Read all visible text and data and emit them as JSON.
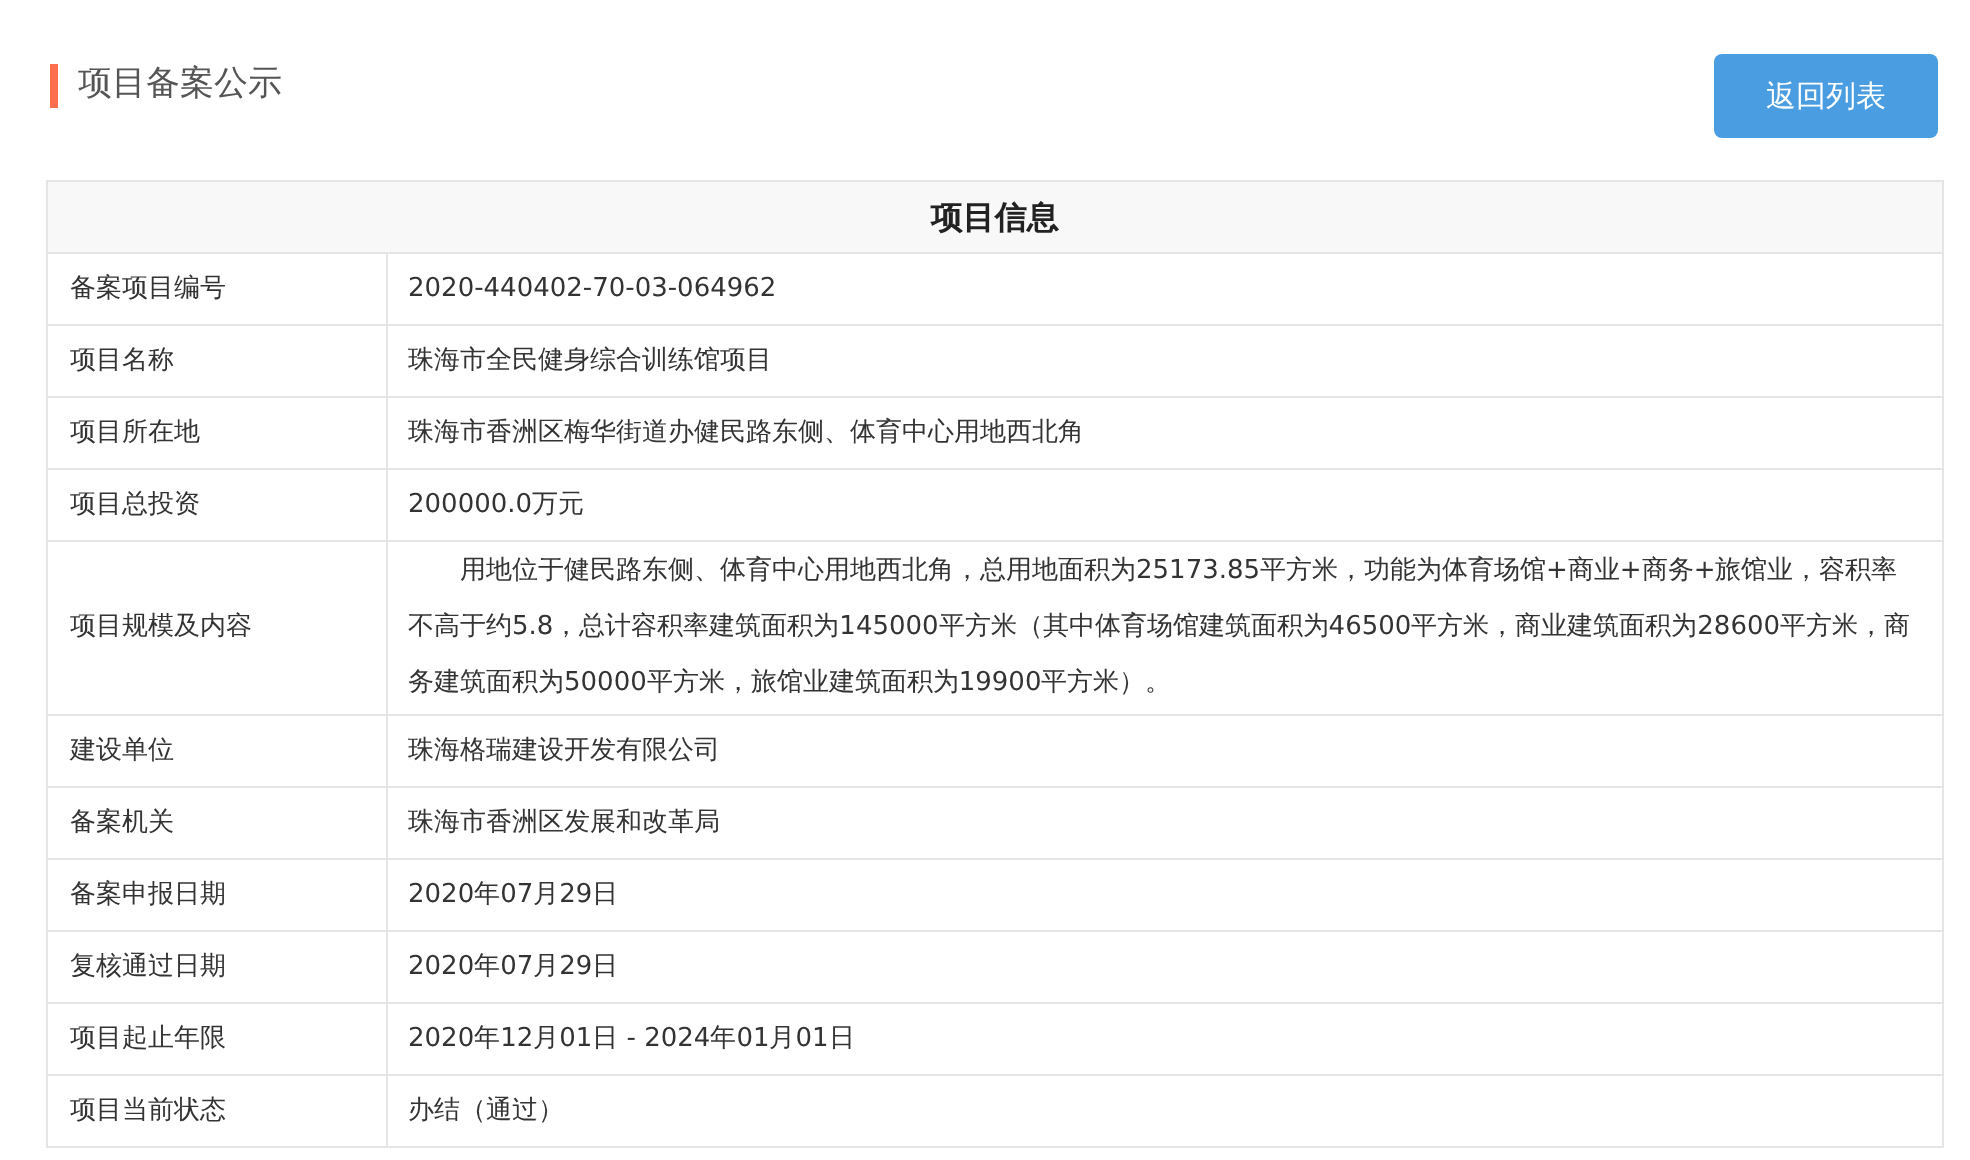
{
  "page_title": "项目备案公示",
  "back_button": "返回列表",
  "table": {
    "title": "项目信息",
    "rows": [
      {
        "label": "备案项目编号",
        "value": "2020-440402-70-03-064962",
        "kind": "text"
      },
      {
        "label": "项目名称",
        "value": "珠海市全民健身综合训练馆项目",
        "kind": "text"
      },
      {
        "label": "项目所在地",
        "value": "珠海市香洲区梅华街道办健民路东侧、体育中心用地西北角",
        "kind": "text"
      },
      {
        "label": "项目总投资",
        "value": "200000.0万元",
        "kind": "text"
      },
      {
        "label": "项目规模及内容",
        "value": "用地位于健民路东侧、体育中心用地西北角，总用地面积为25173.85平方米，功能为体育场馆+商业+商务+旅馆业，容积率不高于约5.8，总计容积率建筑面积为145000平方米（其中体育场馆建筑面积为46500平方米，商业建筑面积为28600平方米，商务建筑面积为50000平方米，旅馆业建筑面积为19900平方米）。",
        "kind": "paragraph"
      },
      {
        "label": "建设单位",
        "value": "珠海格瑞建设开发有限公司",
        "kind": "text"
      },
      {
        "label": "备案机关",
        "value": "珠海市香洲区发展和改革局",
        "kind": "text"
      },
      {
        "label": "备案申报日期",
        "value": "2020年07月29日",
        "kind": "text"
      },
      {
        "label": "复核通过日期",
        "value": "2020年07月29日",
        "kind": "text"
      },
      {
        "label": "项目起止年限",
        "value": "2020年12月01日 - 2024年01月01日",
        "kind": "text"
      },
      {
        "label": "项目当前状态",
        "value": "办结（通过）",
        "kind": "text"
      }
    ]
  }
}
